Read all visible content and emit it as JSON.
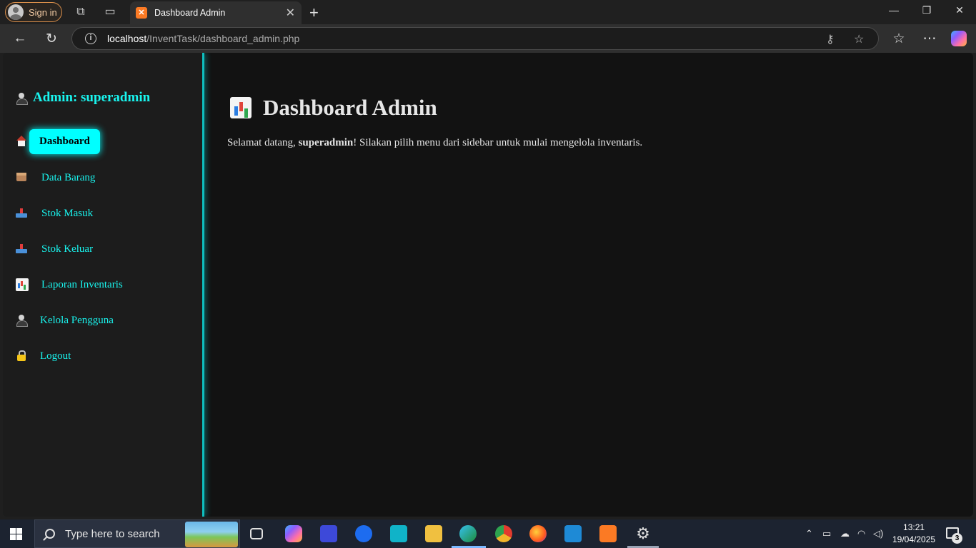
{
  "browser": {
    "signin_label": "Sign in",
    "tab_title": "Dashboard Admin",
    "url_host": "localhost",
    "url_path": "/InventTask/dashboard_admin.php"
  },
  "sidebar": {
    "title": "Admin: superadmin",
    "items": [
      {
        "label": "Dashboard",
        "icon": "house-icon",
        "active": true
      },
      {
        "label": "Data Barang",
        "icon": "box-icon"
      },
      {
        "label": "Stok Masuk",
        "icon": "inbox-tray-icon"
      },
      {
        "label": "Stok Keluar",
        "icon": "outbox-tray-icon"
      },
      {
        "label": "Laporan Inventaris",
        "icon": "bar-chart-icon"
      },
      {
        "label": "Kelola Pengguna",
        "icon": "person-icon"
      },
      {
        "label": "Logout",
        "icon": "lock-icon"
      }
    ]
  },
  "main": {
    "title": "Dashboard Admin",
    "welcome_prefix": "Selamat datang, ",
    "welcome_user": "superadmin",
    "welcome_suffix": "! Silakan pilih menu dari sidebar untuk mulai mengelola inventaris."
  },
  "taskbar": {
    "search_placeholder": "Type here to search",
    "time": "13:21",
    "date": "19/04/2025",
    "notification_count": "3"
  },
  "colors": {
    "accent": "#00ffff",
    "sidebar_bg": "#1c1c1c",
    "page_bg": "#121212",
    "sidebar_border": "#0fbfbf"
  }
}
